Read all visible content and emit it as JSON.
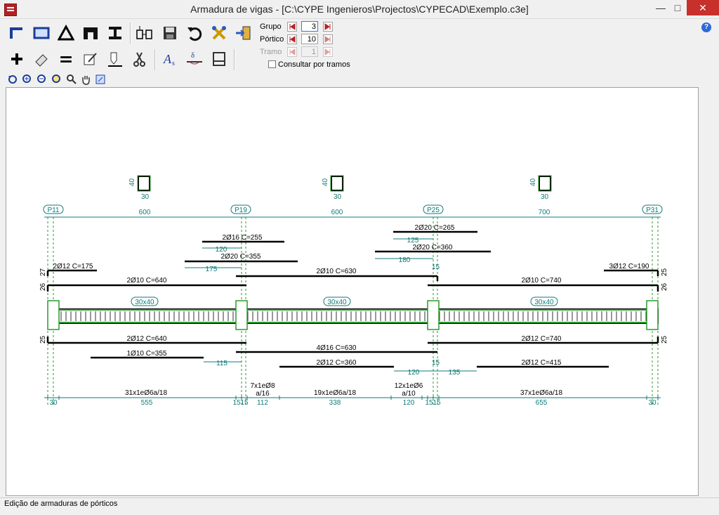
{
  "window": {
    "title": "Armadura de vigas - [C:\\CYPE Ingenieros\\Projectos\\CYPECAD\\Exemplo.c3e]"
  },
  "toolbar": {
    "grupo_label": "Grupo",
    "grupo_value": "3",
    "portico_label": "Pórtico",
    "portico_value": "10",
    "tramo_label": "Tramo",
    "tramo_value": "1",
    "consultar_label": "Consultar por tramos"
  },
  "status": {
    "text": "Edição de armaduras de pórticos"
  },
  "drawing": {
    "columns": [
      "P11",
      "P19",
      "P25",
      "P31"
    ],
    "spans": [
      "600",
      "600",
      "700"
    ],
    "column_sections": [
      {
        "h": "40",
        "w": "30"
      },
      {
        "h": "40",
        "w": "30"
      },
      {
        "h": "40",
        "w": "30"
      }
    ],
    "beam_sections": [
      "30x40",
      "30x40",
      "30x40"
    ],
    "top_bars": {
      "b1": "2Ø16 C=255",
      "b1_dim": "120",
      "b2": "2Ø20 C=355",
      "b2_dim": "175",
      "b3": "2Ø20 C=265",
      "b3_dim": "125",
      "b4": "2Ø20 C=360",
      "b4_dim": "180",
      "b5": "2Ø12 C=175",
      "b6": "3Ø12 C=190",
      "b7": "2Ø10 C=640",
      "b8": "2Ø10 C=630",
      "b9": "2Ø10 C=740",
      "dim15": "15"
    },
    "bottom_bars": {
      "b1": "2Ø12 C=640",
      "b2": "2Ø12 C=740",
      "b3": "1Ø10 C=355",
      "b3_dim": "115",
      "b4": "4Ø16 C=630",
      "b5": "2Ø12 C=360",
      "b5_dim": "120",
      "b6": "2Ø12 C=415",
      "b6_dim": "135",
      "dim15": "15"
    },
    "left_side": {
      "v1": "27",
      "v2": "26",
      "v3": "25"
    },
    "right_side": {
      "v1": "25",
      "v2": "26",
      "v3": "25"
    },
    "stirrups": {
      "s1": "31x1eØ6a/18",
      "s2a": "7x1eØ8",
      "s2b": "a/16",
      "s3": "19x1eØ6a/18",
      "s4a": "12x1eØ6",
      "s4b": "a/10",
      "s5": "37x1eØ6a/18"
    },
    "stirrup_dims": [
      "30",
      "555",
      "15",
      "15",
      "112",
      "338",
      "120",
      "15",
      "15",
      "655",
      "30"
    ]
  }
}
